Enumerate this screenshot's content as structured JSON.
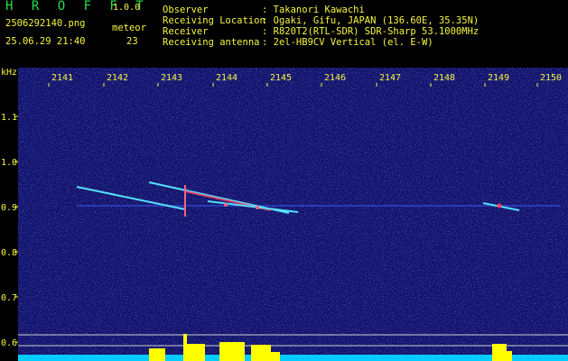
{
  "app": {
    "name": "H R O F F T",
    "version": "1.0.0"
  },
  "file": "2506292140.png",
  "datetime": "25.06.29 21:40",
  "meteor": {
    "label": "meteor",
    "count": "23"
  },
  "meta": [
    {
      "key": "Observer",
      "value": ": Takanori Kawachi"
    },
    {
      "key": "Receiving Location",
      "value": ": Ogaki, Gifu, JAPAN (136.60E, 35.35N)"
    },
    {
      "key": "Receiver",
      "value": ": R820T2(RTL-SDR) SDR-Sharp 53.1000MHz"
    },
    {
      "key": "Receiving antenna",
      "value": ": 2el-HB9CV Vertical (el. E-W)"
    }
  ],
  "axis": {
    "y_unit": "kHz",
    "y_ticks": [
      "1.1",
      "1.0",
      "0.9",
      "0.8",
      "0.7",
      "0.6"
    ],
    "x_ticks": [
      "2141",
      "2142",
      "2143",
      "2144",
      "2145",
      "2146",
      "2147",
      "2148",
      "2149",
      "2150"
    ]
  },
  "colors": {
    "label": "#f5f542",
    "title": "#22e044",
    "background": "#12126a",
    "trace": "#55e0ff",
    "bars": "#ffff00",
    "baseline": "#00ccff"
  }
}
